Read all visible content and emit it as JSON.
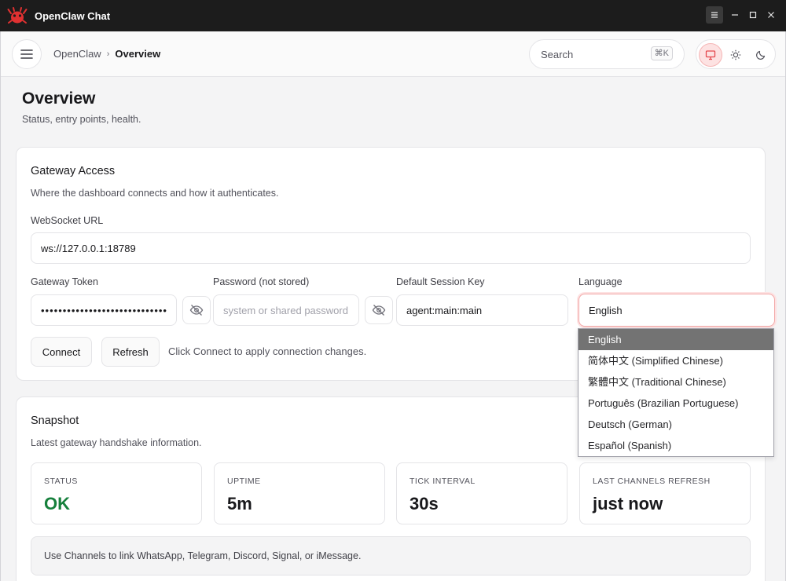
{
  "window": {
    "title": "OpenClaw Chat"
  },
  "header": {
    "breadcrumb": {
      "root": "OpenClaw",
      "current": "Overview"
    },
    "search": {
      "placeholder": "Search",
      "shortcut": "⌘K"
    }
  },
  "page": {
    "title": "Overview",
    "subtitle": "Status, entry points, health."
  },
  "gateway": {
    "title": "Gateway Access",
    "subtitle": "Where the dashboard connects and how it authenticates.",
    "ws_label": "WebSocket URL",
    "ws_value": "ws://127.0.0.1:18789",
    "token_label": "Gateway Token",
    "token_value": "••••••••••••••••••••••••••••••",
    "password_label": "Password (not stored)",
    "password_placeholder": "system or shared password",
    "session_label": "Default Session Key",
    "session_value": "agent:main:main",
    "language_label": "Language",
    "language_value": "English",
    "connect_label": "Connect",
    "refresh_label": "Refresh",
    "hint": "Click Connect to apply connection changes."
  },
  "language_options": [
    "English",
    "简体中文 (Simplified Chinese)",
    "繁體中文 (Traditional Chinese)",
    "Português (Brazilian Portuguese)",
    "Deutsch (German)",
    "Español (Spanish)"
  ],
  "snapshot": {
    "title": "Snapshot",
    "subtitle": "Latest gateway handshake information.",
    "stats": [
      {
        "label": "STATUS",
        "value": "OK"
      },
      {
        "label": "UPTIME",
        "value": "5m"
      },
      {
        "label": "TICK INTERVAL",
        "value": "30s"
      },
      {
        "label": "LAST CHANNELS REFRESH",
        "value": "just now"
      }
    ],
    "info": "Use Channels to link WhatsApp, Telegram, Discord, Signal, or iMessage."
  },
  "colors": {
    "accent": "#e5484d",
    "status_ok": "#16803c",
    "titlebar": "#1c1c1c"
  }
}
